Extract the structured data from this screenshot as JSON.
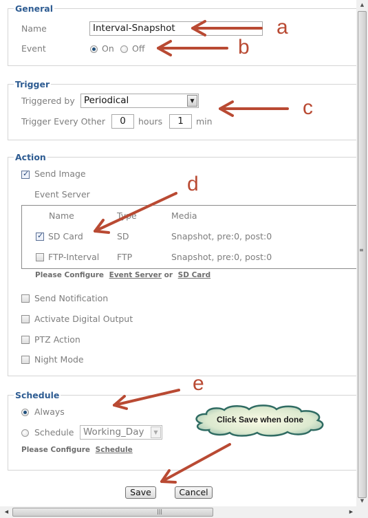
{
  "general": {
    "legend": "General",
    "name_label": "Name",
    "name_value": "Interval-Snapshot",
    "event_label": "Event",
    "event_on_label": "On",
    "event_off_label": "Off",
    "event_selected": "On"
  },
  "trigger": {
    "legend": "Trigger",
    "triggered_by_label": "Triggered by",
    "triggered_by_value": "Periodical",
    "every_label": "Trigger Every Other",
    "hours_value": "0",
    "hours_label": "hours",
    "min_value": "1",
    "min_label": "min"
  },
  "action": {
    "legend": "Action",
    "send_image_label": "Send Image",
    "send_image_checked": true,
    "event_server_label": "Event Server",
    "table": {
      "headers": [
        "Name",
        "Type",
        "Media"
      ],
      "rows": [
        {
          "checked": true,
          "name": "SD Card",
          "type": "SD",
          "media": "Snapshot, pre:0, post:0"
        },
        {
          "checked": false,
          "name": "FTP-Interval",
          "type": "FTP",
          "media": "Snapshot, pre:0, post:0"
        }
      ]
    },
    "configure_prefix": "Please Configure",
    "configure_link1": "Event Server",
    "configure_or": "or",
    "configure_link2": "SD Card",
    "options": [
      {
        "label": "Send Notification",
        "checked": false
      },
      {
        "label": "Activate Digital Output",
        "checked": false
      },
      {
        "label": "PTZ Action",
        "checked": false
      },
      {
        "label": "Night Mode",
        "checked": false
      }
    ]
  },
  "schedule": {
    "legend": "Schedule",
    "always_label": "Always",
    "schedule_label": "Schedule",
    "schedule_value": "Working_Day",
    "selected": "Always",
    "configure_prefix": "Please Configure",
    "configure_link": "Schedule"
  },
  "buttons": {
    "save": "Save",
    "cancel": "Cancel"
  },
  "annotations": {
    "a": "a",
    "b": "b",
    "c": "c",
    "d": "d",
    "e": "e",
    "callout": "Click Save when done",
    "arrow_color": "#b94a33",
    "cloud_fill": "#eef2d8",
    "cloud_stroke": "#2f6b62"
  },
  "colors": {
    "legend": "#2e5c92",
    "label": "#7d7d7d"
  }
}
